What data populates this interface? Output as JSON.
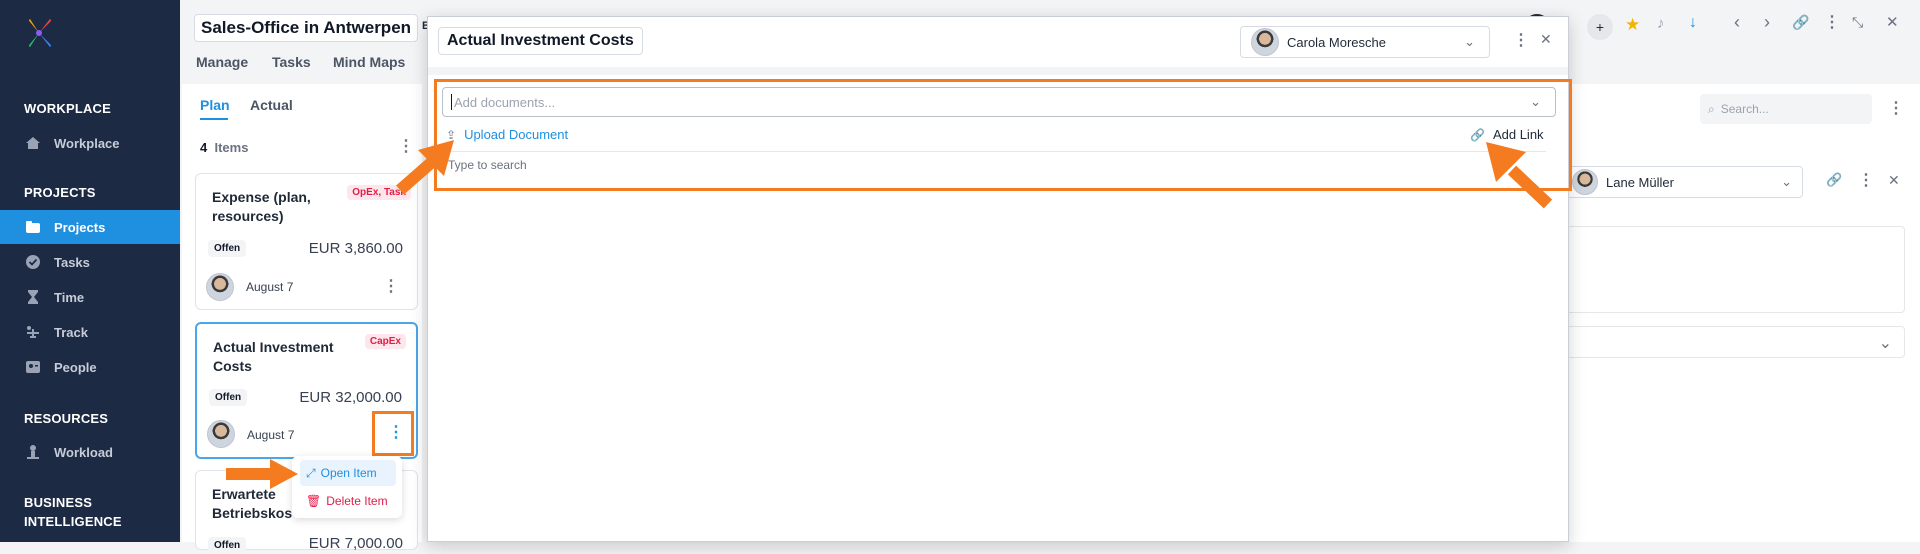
{
  "sidebar": {
    "sections": [
      {
        "label": "WORKPLACE"
      },
      {
        "label": "PROJECTS"
      },
      {
        "label": "RESOURCES"
      },
      {
        "label": "BUSINESS INTELLIGENCE"
      }
    ],
    "items": [
      {
        "label": "Workplace",
        "icon": "home-icon"
      },
      {
        "label": "Projects",
        "icon": "folder-icon"
      },
      {
        "label": "Tasks",
        "icon": "check-circle-icon"
      },
      {
        "label": "Time",
        "icon": "hourglass-icon"
      },
      {
        "label": "Track",
        "icon": "track-icon"
      },
      {
        "label": "People",
        "icon": "people-icon"
      },
      {
        "label": "Workload",
        "icon": "workload-icon"
      }
    ]
  },
  "project": {
    "title": "Sales-Office in Antwerpen",
    "title_suffix": "B",
    "nav": [
      "Manage",
      "Tasks",
      "Mind Maps"
    ]
  },
  "list": {
    "tabs": [
      "Plan",
      "Actual"
    ],
    "count": "4",
    "count_label": "Items",
    "cards": [
      {
        "title": "Expense (plan, resources)",
        "tag": "OpEx, Task",
        "status": "Offen",
        "amount": "EUR 3,860.00",
        "date": "August 7"
      },
      {
        "title": "Actual Investment Costs",
        "tag": "CapEx",
        "status": "Offen",
        "amount": "EUR 32,000.00",
        "date": "August 7"
      },
      {
        "title": "Erwartete Betriebskos",
        "status": "Offen",
        "amount": "EUR 7,000.00"
      }
    ]
  },
  "context_menu": {
    "open": "Open Item",
    "delete": "Delete Item"
  },
  "modal": {
    "title": "Actual Investment Costs",
    "assignee": "Carola Moresche",
    "documents_placeholder": "Add documents...",
    "upload": "Upload Document",
    "add_link": "Add Link",
    "type_to_search": "Type to search"
  },
  "right_panel": {
    "search_placeholder": "Search...",
    "assignee": "Lane Müller"
  },
  "colors": {
    "sidebar_bg": "#1d2a44",
    "accent": "#1f8fe0",
    "annotation": "#f47b20",
    "tag_red": "#e11d48"
  }
}
